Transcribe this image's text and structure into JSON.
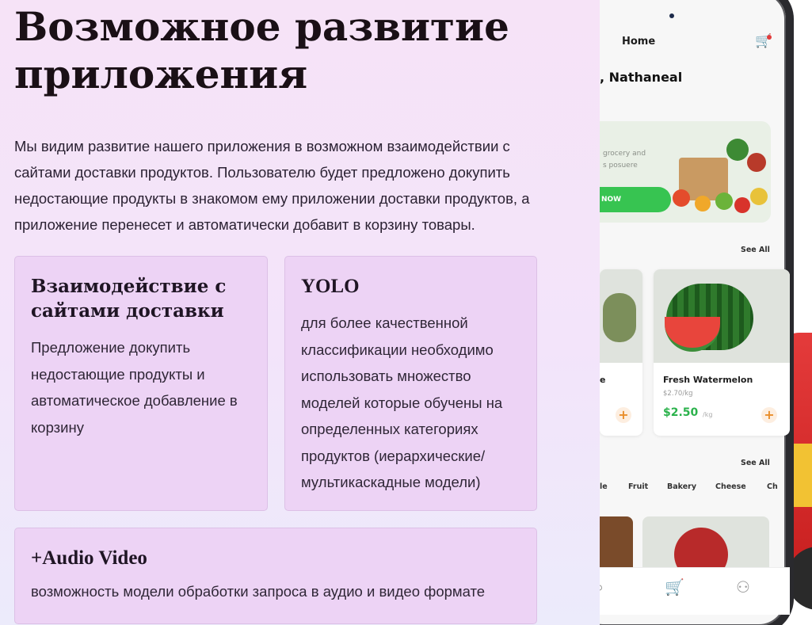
{
  "slide": {
    "title": "Возможное развитие приложения",
    "intro": "Мы видим развитие нашего приложения в возможном взаимодействии с сайтами доставки продуктов. Пользователю будет предложено докупить недостающие продукты в знакомом ему приложении доставки продуктов, а приложение  перенесет и автоматически добавит в корзину товары.",
    "cards": [
      {
        "title": "Взаимодействие с сайтами доставки",
        "body": "Предложение докупить недостающие продукты и автоматическое добавление в корзину"
      },
      {
        "title": "YOLO",
        "body": "для более качественной классификации необходимо использовать множество моделей которые обучены на определенных категориях продуктов (иерархические/мультикаскадные модели)"
      },
      {
        "title": "+Audio Video",
        "body": "возможность модели обработки запроса в аудио и видео формате"
      }
    ]
  },
  "phone": {
    "header_title": "Home",
    "greeting": ", Nathaneal",
    "banner_text": "grocery and\ns posuere",
    "banner_button": "NOW",
    "see_all_1": "See All",
    "see_all_2": "See All",
    "product_partial_name": "e",
    "product_name": "Fresh Watermelon",
    "product_old_price": "$2.70/kg",
    "product_price": "$2.50",
    "product_unit": "/kg",
    "categories": [
      "le",
      "Fruit",
      "Bakery",
      "Cheese",
      "Ch"
    ],
    "icons": [
      "cart-icon",
      "plus-icon",
      "search-icon",
      "user-icon"
    ],
    "accent_green": "#2bb24c",
    "accent_orange": "#e98e2b"
  }
}
